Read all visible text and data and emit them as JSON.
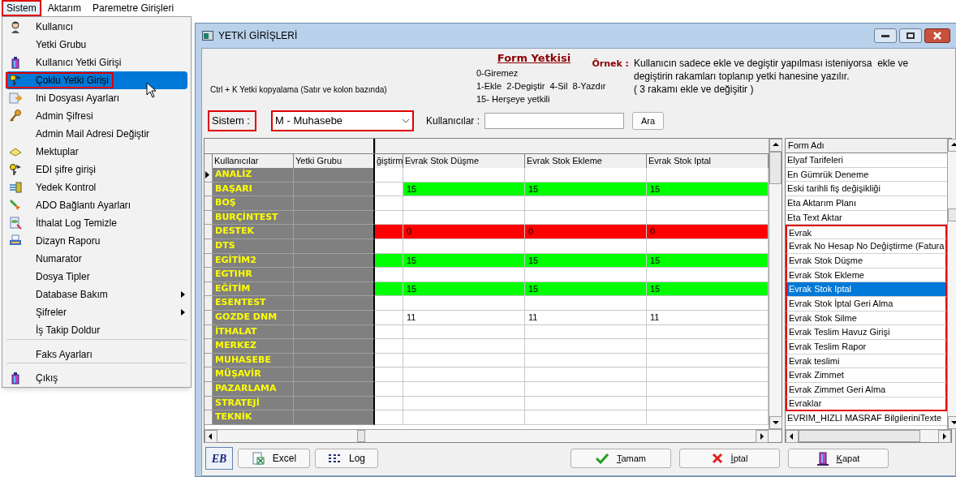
{
  "menubar": [
    {
      "label": "Sistem",
      "selected": true,
      "highlighted": true
    },
    {
      "label": "Aktarım",
      "selected": false,
      "highlighted": false
    },
    {
      "label": "Paremetre Girişleri",
      "selected": false,
      "highlighted": false
    }
  ],
  "menu": {
    "items": [
      {
        "label": "Kullanıcı",
        "selected": false,
        "highlighted": false,
        "submenu": false,
        "separator_before": false
      },
      {
        "label": "Yetki Grubu",
        "selected": false,
        "highlighted": false,
        "submenu": false,
        "separator_before": false
      },
      {
        "label": "Kullanıcı Yetki Girişi",
        "selected": false,
        "highlighted": false,
        "submenu": false,
        "separator_before": false
      },
      {
        "label": "Çoklu Yetki Girişi",
        "selected": true,
        "highlighted": true,
        "submenu": false,
        "separator_before": false
      },
      {
        "label": "Ini Dosyası  Ayarları",
        "selected": false,
        "highlighted": false,
        "submenu": false,
        "separator_before": false
      },
      {
        "label": "Admin Şifresi",
        "selected": false,
        "highlighted": false,
        "submenu": false,
        "separator_before": false
      },
      {
        "label": "Admin Mail Adresi Değiştir",
        "selected": false,
        "highlighted": false,
        "submenu": false,
        "separator_before": false
      },
      {
        "label": "Mektuplar",
        "selected": false,
        "highlighted": false,
        "submenu": false,
        "separator_before": false
      },
      {
        "label": "EDI şifre girişi",
        "selected": false,
        "highlighted": false,
        "submenu": false,
        "separator_before": false
      },
      {
        "label": "Yedek Kontrol",
        "selected": false,
        "highlighted": false,
        "submenu": false,
        "separator_before": false
      },
      {
        "label": "ADO Bağlantı Ayarları",
        "selected": false,
        "highlighted": false,
        "submenu": false,
        "separator_before": false
      },
      {
        "label": "İthalat Log Temizle",
        "selected": false,
        "highlighted": false,
        "submenu": false,
        "separator_before": false
      },
      {
        "label": "Dizayn Raporu",
        "selected": false,
        "highlighted": false,
        "submenu": false,
        "separator_before": false
      },
      {
        "label": "Numarator",
        "selected": false,
        "highlighted": false,
        "submenu": false,
        "separator_before": false
      },
      {
        "label": "Dosya Tipler",
        "selected": false,
        "highlighted": false,
        "submenu": false,
        "separator_before": false
      },
      {
        "label": "Database Bakım",
        "selected": false,
        "highlighted": false,
        "submenu": true,
        "separator_before": false
      },
      {
        "label": "Şifreler",
        "selected": false,
        "highlighted": false,
        "submenu": true,
        "separator_before": false
      },
      {
        "label": "İş Takip Doldur",
        "selected": false,
        "highlighted": false,
        "submenu": false,
        "separator_before": false
      },
      {
        "label": "Faks Ayarları",
        "selected": false,
        "highlighted": false,
        "submenu": false,
        "separator_before": true
      },
      {
        "label": "Çıkış",
        "selected": false,
        "highlighted": false,
        "submenu": false,
        "separator_before": true
      }
    ]
  },
  "window": {
    "title": "YETKİ GİRİŞLERİ",
    "copy_hint": "Ctrl + K Yetki kopyalama (Satır ve kolon bazında)",
    "legend_title": "Form Yetkisi",
    "legend_lines": [
      "0-Giremez",
      "1-Ekle  2-Degiştir  4-Sil  8-Yazdır",
      "15- Herşeye yetkili"
    ],
    "example_label": "Örnek :",
    "example_lines": [
      "Kullanıcın sadece ekle ve degiştir yapılması isteniyorsa  ekle ve",
      "degiştirin rakamları toplanıp yetki hanesine yazılır.",
      "( 3 rakamı ekle ve değişitir )"
    ],
    "filter": {
      "system_label": "Sistem :",
      "system_highlighted": true,
      "system_value": "M - Muhasebe",
      "users_label": "Kullanıcılar :",
      "search_button": "Ara"
    },
    "grid": {
      "columns": [
        "Kullanıcılar",
        "Yetki Grubu",
        "ğiştirm",
        "Evrak Stok Düşme",
        "Evrak Stok Ekleme",
        "Evrak Stok Iptal"
      ],
      "rows": [
        {
          "user": "ANALİZ",
          "selected": true
        },
        {
          "user": "BAŞARI",
          "selected": false,
          "cells": [
            {},
            {
              "value": "15",
              "color": "#00ff00"
            },
            {
              "value": "15",
              "color": "#00ff00"
            },
            {
              "value": "15",
              "color": "#00ff00"
            }
          ]
        },
        {
          "user": "BOŞ",
          "selected": false
        },
        {
          "user": "BURÇİNTEST",
          "selected": false
        },
        {
          "user": "DESTEK",
          "selected": false,
          "cells": [
            {
              "color": "#ff0000"
            },
            {
              "value": "0",
              "color": "#ff0000"
            },
            {
              "value": "0",
              "color": "#ff0000"
            },
            {
              "value": "0",
              "color": "#ff0000"
            }
          ]
        },
        {
          "user": "DTS",
          "selected": false
        },
        {
          "user": "EGİTİM2",
          "selected": false,
          "cells": [
            {
              "color": "#00ff00"
            },
            {
              "value": "15",
              "color": "#00ff00"
            },
            {
              "value": "15",
              "color": "#00ff00"
            },
            {
              "value": "15",
              "color": "#00ff00"
            }
          ]
        },
        {
          "user": "EGTIHR",
          "selected": false
        },
        {
          "user": "EĞİTİM",
          "selected": false,
          "cells": [
            {
              "color": "#00ff00"
            },
            {
              "value": "15",
              "color": "#00ff00"
            },
            {
              "value": "15",
              "color": "#00ff00"
            },
            {
              "value": "15",
              "color": "#00ff00"
            }
          ]
        },
        {
          "user": "ESENTEST",
          "selected": false
        },
        {
          "user": "GOZDE DNM",
          "selected": false,
          "cells": [
            {},
            {
              "value": "11"
            },
            {
              "value": "11"
            },
            {
              "value": "11"
            }
          ]
        },
        {
          "user": "İTHALAT",
          "selected": false
        },
        {
          "user": "MERKEZ",
          "selected": false
        },
        {
          "user": "MUHASEBE",
          "selected": false
        },
        {
          "user": "MÜŞAVİR",
          "selected": false
        },
        {
          "user": "PAZARLAMA",
          "selected": false
        },
        {
          "user": "STRATEJİ",
          "selected": false
        },
        {
          "user": "TEKNİK",
          "selected": false
        }
      ]
    },
    "form_list": {
      "header": "Form Adı",
      "items": [
        {
          "label": "Elyaf Tarifeleri",
          "selected": false,
          "highlighted": false
        },
        {
          "label": "En Gümrük Deneme",
          "selected": false,
          "highlighted": false
        },
        {
          "label": "Eski tarihli fiş değişikliği",
          "selected": false,
          "highlighted": false
        },
        {
          "label": "Eta Aktarım Planı",
          "selected": false,
          "highlighted": false
        },
        {
          "label": "Eta Text Aktar",
          "selected": false,
          "highlighted": false
        },
        {
          "label": "Evrak",
          "selected": false,
          "highlighted": true
        },
        {
          "label": "Evrak No Hesap No Değiştirme (Fatura",
          "selected": false,
          "highlighted": true
        },
        {
          "label": "Evrak Stok Düşme",
          "selected": false,
          "highlighted": true
        },
        {
          "label": "Evrak Stok Ekleme",
          "selected": false,
          "highlighted": true
        },
        {
          "label": "Evrak Stok Iptal",
          "selected": true,
          "highlighted": true
        },
        {
          "label": "Evrak Stok İptal Geri Alma",
          "selected": false,
          "highlighted": true
        },
        {
          "label": "Evrak Stok Silme",
          "selected": false,
          "highlighted": true
        },
        {
          "label": "Evrak Teslim Havuz Girişi",
          "selected": false,
          "highlighted": true
        },
        {
          "label": "Evrak Teslim Rapor",
          "selected": false,
          "highlighted": true
        },
        {
          "label": "Evrak teslimi",
          "selected": false,
          "highlighted": true
        },
        {
          "label": "Evrak Zimmet",
          "selected": false,
          "highlighted": true
        },
        {
          "label": "Evrak Zimmet Geri Alma",
          "selected": false,
          "highlighted": true
        },
        {
          "label": "Evraklar",
          "selected": false,
          "highlighted": true
        },
        {
          "label": "EVRIM_HIZLI MASRAF BilgileriniTexte",
          "selected": false,
          "highlighted": false
        }
      ]
    },
    "buttons": [
      {
        "label": "EB",
        "kind": "logo"
      },
      {
        "label": "Excel",
        "kind": "excel"
      },
      {
        "label": "Log",
        "kind": "log"
      },
      {
        "label": "Tamam",
        "kind": "ok"
      },
      {
        "label": "İptal",
        "kind": "cancel"
      },
      {
        "label": "Kapat",
        "kind": "close"
      }
    ]
  }
}
